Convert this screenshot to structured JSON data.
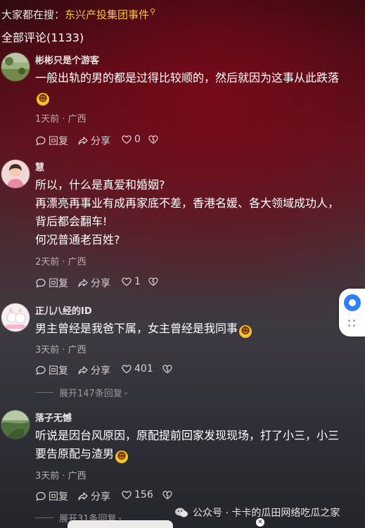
{
  "search": {
    "prefix": "大家都在搜：",
    "term": "东兴产投集团事件",
    "icon": "search-icon"
  },
  "comments_header": "全部评论(1133)",
  "actions": {
    "reply": "回复",
    "share": "分享"
  },
  "comments": [
    {
      "username": "彬彬只是个游客",
      "lines": [
        "一般出轨的男的都是过得比较顺的，然后就因为这事从此跌落"
      ],
      "emoji_line": true,
      "meta": "1天前 · 广西",
      "likes": "0"
    },
    {
      "username": "慧",
      "lines": [
        "所以，什么是真爱和婚姻?",
        "再漂亮再事业有成再家底不差，香港名媛、各大领域成功人，",
        "背后都会翻车!",
        "何况普通老百姓?"
      ],
      "meta": "2天前 · 广西",
      "likes": "1"
    },
    {
      "username": "正儿八经的ID",
      "lines": [
        "男主曾经是我爸下属，女主曾经是我同事"
      ],
      "meta": "3天前 · 广西",
      "likes": "401",
      "expand": "展开147条回复"
    },
    {
      "username": "落子无憾",
      "lines": [
        "听说是因台风原因，原配提前回家发现现场，打了小三，小三",
        "要告原配与渣男"
      ],
      "meta": "3天前 · 广西",
      "likes": "156",
      "expand": "展开31条回复"
    }
  ],
  "watermark": "公众号 · 卡卡的瓜田网络吃瓜之家",
  "colors": {
    "accent_search": "#f2c64a",
    "float_button": "#2f7dfc"
  }
}
